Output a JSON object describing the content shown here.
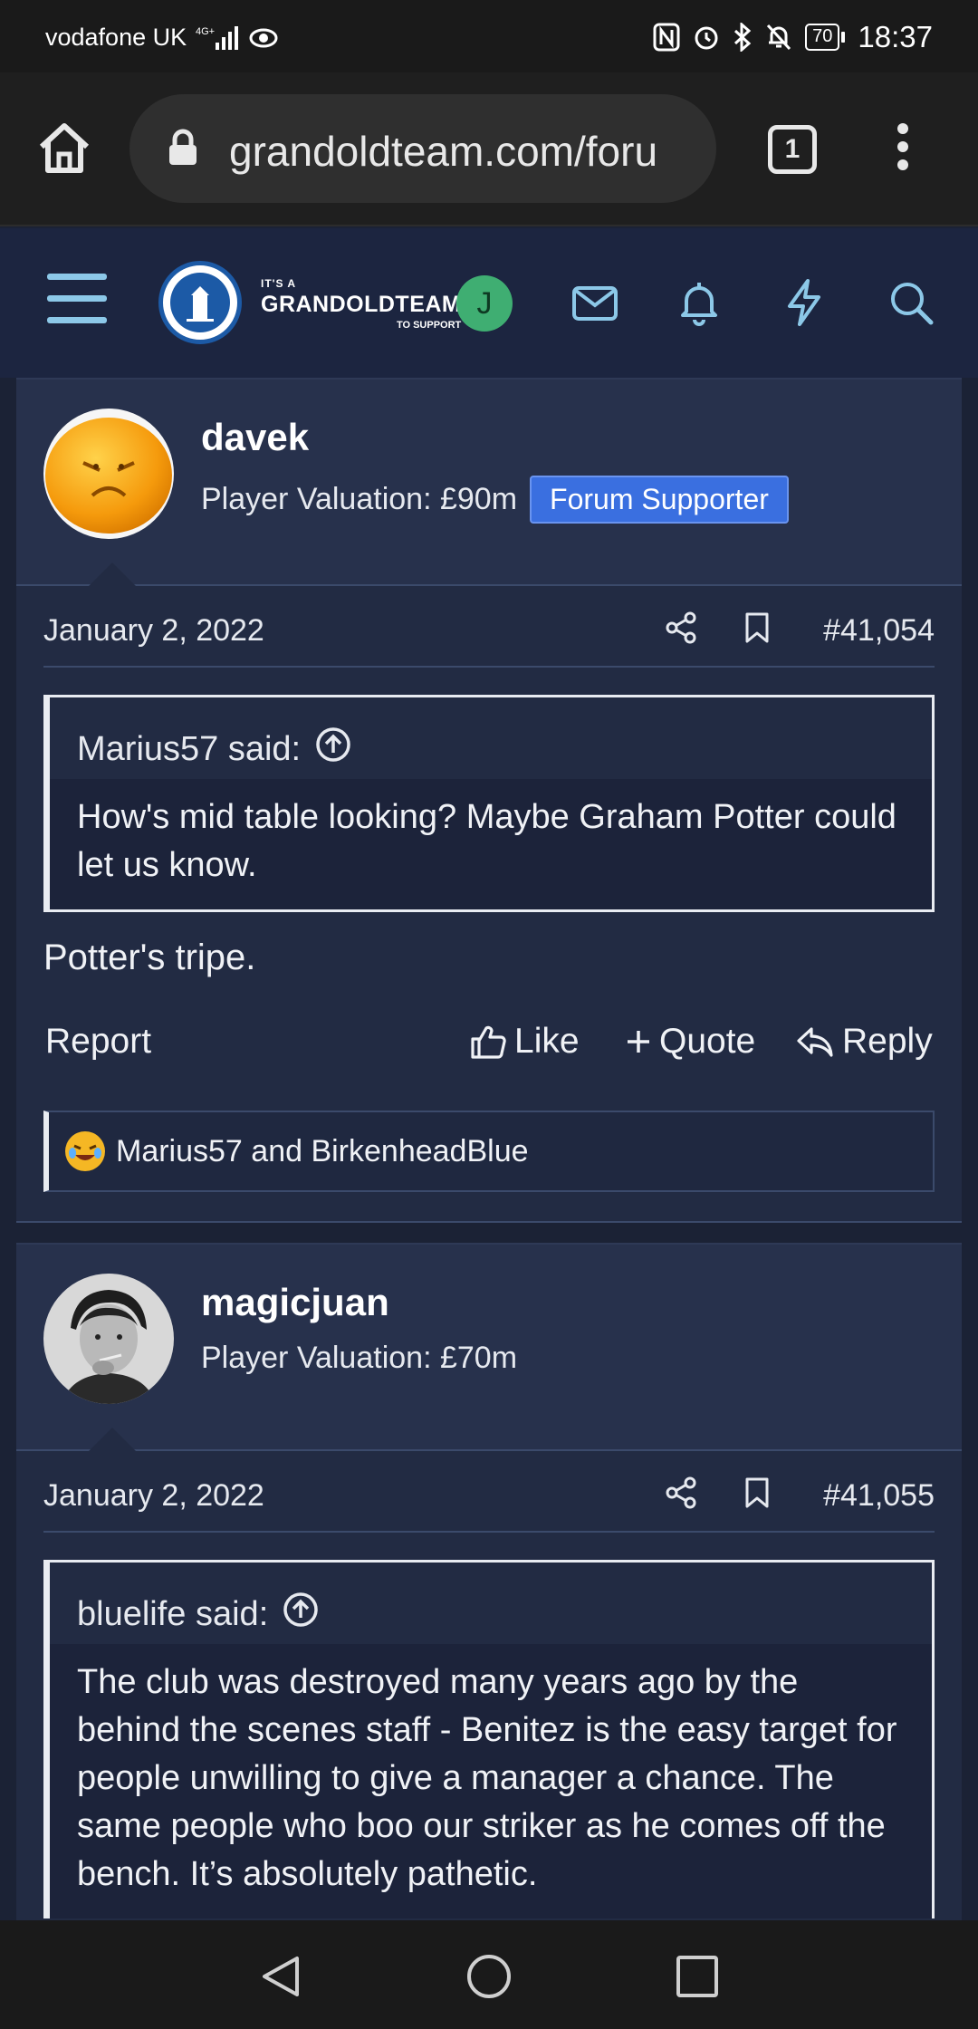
{
  "status_bar": {
    "carrier": "vodafone UK",
    "network": "4G+",
    "battery": "70",
    "time": "18:37"
  },
  "browser": {
    "url": "grandoldteam.com/foru",
    "tab_count": "1"
  },
  "site": {
    "logo_small": "IT'S A",
    "logo_big": "GRANDOLDTEAM",
    "logo_tiny": "TO SUPPORT",
    "user_initial": "J"
  },
  "posts": [
    {
      "username": "davek",
      "valuation": "Player Valuation: £90m",
      "badge": "Forum Supporter",
      "date": "January 2, 2022",
      "post_number": "#41,054",
      "quote_author": "Marius57 said:",
      "quote_text": "How's mid table looking? Maybe Graham Potter could let us know.",
      "message": "Potter's tripe.",
      "report_label": "Report",
      "like_label": "Like",
      "quote_label": "Quote",
      "reply_label": "Reply",
      "reactions": "Marius57 and BirkenheadBlue"
    },
    {
      "username": "magicjuan",
      "valuation": "Player Valuation: £70m",
      "date": "January 2, 2022",
      "post_number": "#41,055",
      "quote_author": "bluelife said:",
      "quote_text": "The club was destroyed many years ago by the behind the scenes staff - Benitez is the easy target for people unwilling to give a manager a chance. The same people who boo our striker as he comes off the bench. It’s absolutely pathetic."
    }
  ]
}
